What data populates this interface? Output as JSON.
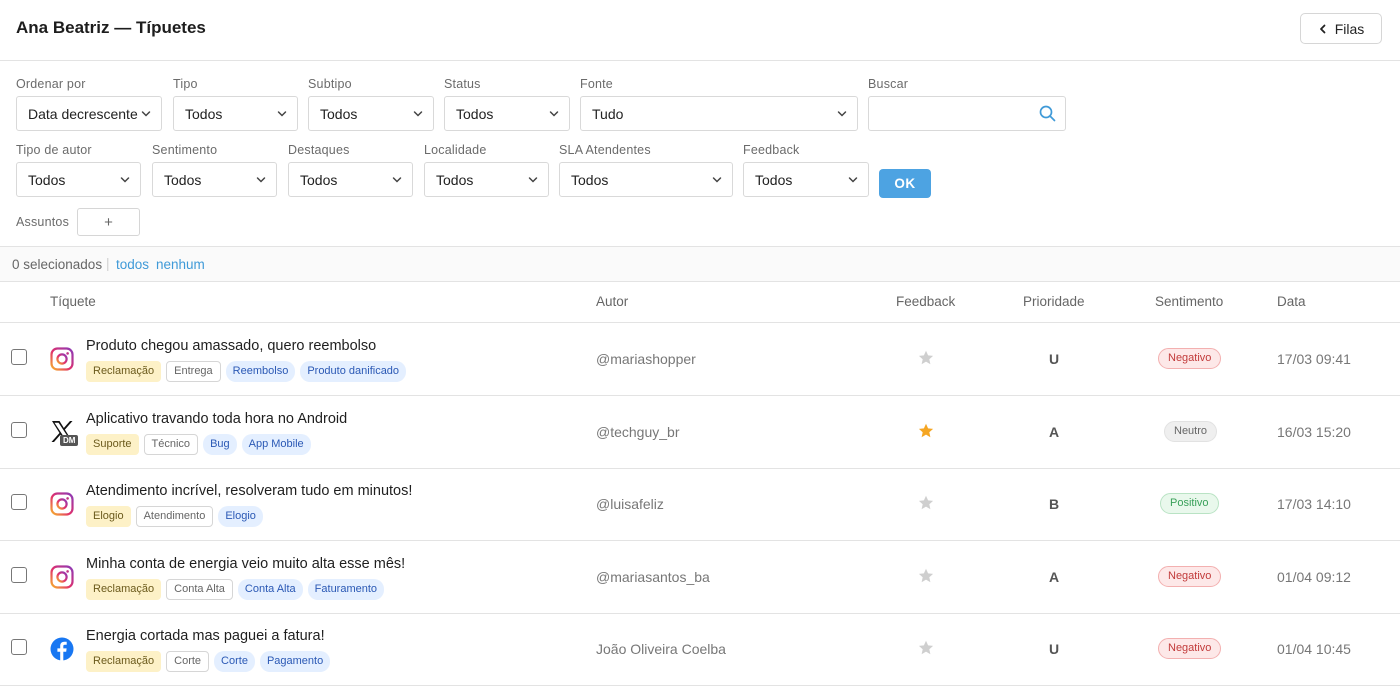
{
  "header": {
    "title": "Ana Beatriz — Típuetes",
    "back_label": "Filas"
  },
  "filters": {
    "order": {
      "label": "Ordenar por",
      "value": "Data decrescente"
    },
    "type": {
      "label": "Tipo",
      "value": "Todos"
    },
    "subtype": {
      "label": "Subtipo",
      "value": "Todos"
    },
    "status": {
      "label": "Status",
      "value": "Todos"
    },
    "source": {
      "label": "Fonte",
      "value": "Tudo"
    },
    "search": {
      "label": "Buscar",
      "value": ""
    },
    "author_type": {
      "label": "Tipo de autor",
      "value": "Todos"
    },
    "sentiment": {
      "label": "Sentimento",
      "value": "Todos"
    },
    "highlights": {
      "label": "Destaques",
      "value": "Todos"
    },
    "location": {
      "label": "Localidade",
      "value": "Todos"
    },
    "sla": {
      "label": "SLA Atendentes",
      "value": "Todos"
    },
    "feedback": {
      "label": "Feedback",
      "value": "Todos"
    },
    "ok_label": "OK",
    "subjects_label": "Assuntos",
    "add_label": "+"
  },
  "selection": {
    "count_text": "0 selecionados",
    "separator": "|",
    "all_label": "todos",
    "none_label": "nenhum"
  },
  "columns": {
    "ticket": "Tíquete",
    "author": "Autor",
    "feedback": "Feedback",
    "priority": "Prioridade",
    "sentiment": "Sentimento",
    "date": "Data"
  },
  "rows": [
    {
      "source_icon": "instagram-icon",
      "subject": "Produto chegou amassado, quero reembolso",
      "category": "Reclamação",
      "subtype": "Entrega",
      "tags": [
        "Reembolso",
        "Produto danificado"
      ],
      "author": "@mariashopper",
      "feedback_starred": false,
      "priority": "U",
      "sentiment": "Negativo",
      "sentiment_kind": "neg",
      "date": "17/03 09:41"
    },
    {
      "source_icon": "x-dm-icon",
      "source_badge": "DM",
      "subject": "Aplicativo travando toda hora no Android",
      "category": "Suporte",
      "subtype": "Técnico",
      "tags": [
        "Bug",
        "App Mobile"
      ],
      "author": "@techguy_br",
      "feedback_starred": true,
      "priority": "A",
      "sentiment": "Neutro",
      "sentiment_kind": "neu",
      "date": "16/03 15:20"
    },
    {
      "source_icon": "instagram-icon",
      "subject": "Atendimento incrível, resolveram tudo em minutos!",
      "category": "Elogio",
      "subtype": "Atendimento",
      "tags": [
        "Elogio"
      ],
      "author": "@luisafeliz",
      "feedback_starred": false,
      "priority": "B",
      "sentiment": "Positivo",
      "sentiment_kind": "pos",
      "date": "17/03 14:10"
    },
    {
      "source_icon": "instagram-icon",
      "subject": "Minha conta de energia veio muito alta esse mês!",
      "category": "Reclamação",
      "subtype": "Conta Alta",
      "tags": [
        "Conta Alta",
        "Faturamento"
      ],
      "author": "@mariasantos_ba",
      "feedback_starred": false,
      "priority": "A",
      "sentiment": "Negativo",
      "sentiment_kind": "neg",
      "date": "01/04 09:12"
    },
    {
      "source_icon": "facebook-icon",
      "subject": "Energia cortada mas paguei a fatura!",
      "category": "Reclamação",
      "subtype": "Corte",
      "tags": [
        "Corte",
        "Pagamento"
      ],
      "author": "João Oliveira Coelba",
      "feedback_starred": false,
      "priority": "U",
      "sentiment": "Negativo",
      "sentiment_kind": "neg",
      "date": "01/04 10:45"
    }
  ],
  "colors": {
    "accent": "#4da3e2",
    "star_active": "#f5a623",
    "star_inactive": "#cfcfcf",
    "tag_category_bg": "#fdf1c7",
    "tag_blue_bg": "#e4efff"
  }
}
